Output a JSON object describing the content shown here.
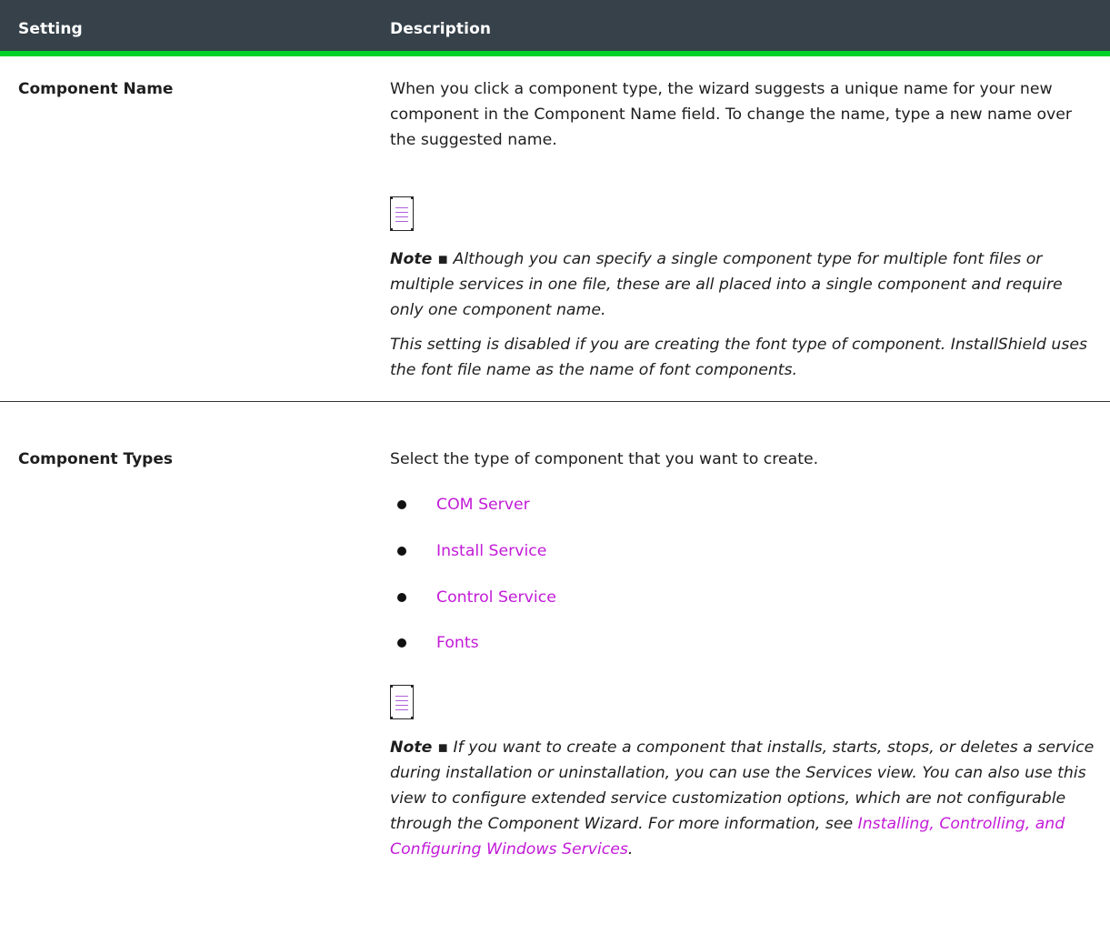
{
  "table": {
    "headers": {
      "setting": "Setting",
      "description": "Description"
    },
    "rows": [
      {
        "setting": "Component Name",
        "description": "When you click a component type, the wizard suggests a unique name for your new component in the Component Name field. To change the name, type a new name over the suggested name.",
        "note_label": "Note ▪",
        "note_text": "Although you can specify a single component type for multiple font files or multiple services in one file, these are all placed into a single component and require only one component name.",
        "extra": "This setting is disabled if you are creating the font type of component. InstallShield uses the font file name as the name of font components."
      },
      {
        "setting": "Component Types",
        "description": "Select the type of component that you want to create.",
        "links": [
          "COM Server",
          "Install Service",
          "Control Service",
          "Fonts"
        ],
        "note_label": "Note ▪",
        "note_text": "If you want to create a component that installs, starts, stops, or deletes a service during installation or uninstallation, you can use the Services view. You can also use this view to configure extended service customization options, which are not configurable through the Component Wizard. For more information, see",
        "note_link": "Installing, Controlling, and Configuring Windows Services",
        "note_end": "."
      }
    ]
  },
  "colors": {
    "header_bg": "#36414a",
    "accent": "#00d12a",
    "link": "#c21bd7"
  },
  "icons": [
    "note-icon"
  ]
}
